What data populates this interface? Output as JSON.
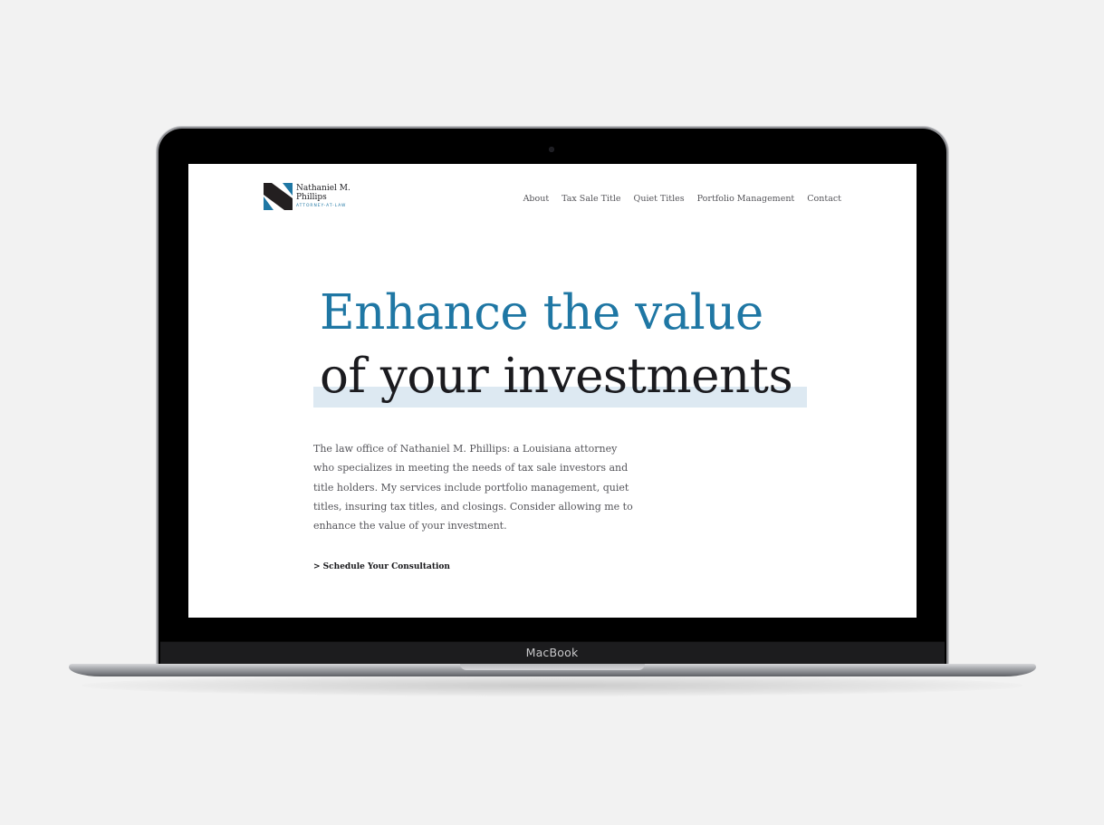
{
  "device": {
    "label": "MacBook"
  },
  "site": {
    "logo": {
      "name_line1": "Nathaniel M.",
      "name_line2": "Phillips",
      "tagline": "ATTORNEY-AT-LAW",
      "icon": "n-monogram-icon"
    },
    "nav": {
      "items": [
        {
          "label": "About"
        },
        {
          "label": "Tax Sale Title"
        },
        {
          "label": "Quiet Titles"
        },
        {
          "label": "Portfolio Management"
        },
        {
          "label": "Contact"
        }
      ]
    },
    "hero": {
      "title_line1": "Enhance the value",
      "title_line2": "of your investments",
      "intro": "The law office of Nathaniel M. Phillips:  a Louisiana attorney who specializes in meeting the needs of tax sale investors and title holders.  My services include portfolio management, quiet titles, insuring tax titles, and closings.  Consider allowing me to enhance the value of your investment.",
      "cta": "> Schedule Your Consultation"
    }
  },
  "colors": {
    "accent_blue": "#1f77a4",
    "highlight": "#dde9f2",
    "dark_text": "#1b1b1f",
    "body_text": "#55555a",
    "background": "#f2f2f2"
  }
}
